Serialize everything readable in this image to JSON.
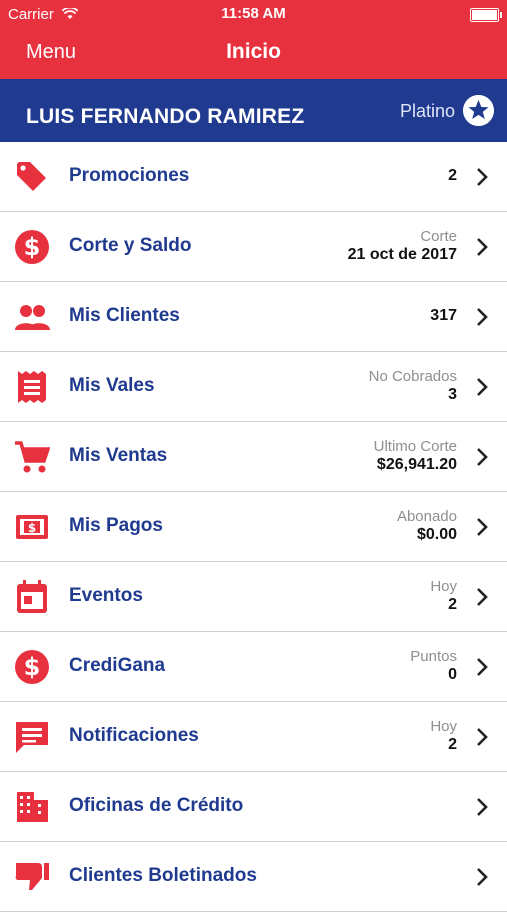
{
  "status": {
    "carrier": "Carrier",
    "time": "11:58 AM"
  },
  "nav": {
    "menu": "Menu",
    "title": "Inicio"
  },
  "user": {
    "name": "LUIS FERNANDO RAMIREZ",
    "tier": "Platino"
  },
  "colors": {
    "red": "#e8313f",
    "navy": "#1f3a8f"
  },
  "items": [
    {
      "label": "Promociones",
      "icon": "tag-icon",
      "sub": "",
      "value": "2"
    },
    {
      "label": "Corte y Saldo",
      "icon": "dollar-circle-icon",
      "sub": "Corte",
      "value": "21 oct de 2017"
    },
    {
      "label": "Mis Clientes",
      "icon": "people-icon",
      "sub": "",
      "value": "317"
    },
    {
      "label": "Mis Vales",
      "icon": "receipt-icon",
      "sub": "No Cobrados",
      "value": "3"
    },
    {
      "label": "Mis Ventas",
      "icon": "cart-icon",
      "sub": "Ultimo Corte",
      "value": "$26,941.20"
    },
    {
      "label": "Mis Pagos",
      "icon": "cash-icon",
      "sub": "Abonado",
      "value": "$0.00"
    },
    {
      "label": "Eventos",
      "icon": "calendar-icon",
      "sub": "Hoy",
      "value": "2"
    },
    {
      "label": "CrediGana",
      "icon": "dollar-circle-icon",
      "sub": "Puntos",
      "value": "0"
    },
    {
      "label": "Notificaciones",
      "icon": "chat-icon",
      "sub": "Hoy",
      "value": "2"
    },
    {
      "label": "Oficinas de Crédito",
      "icon": "building-icon",
      "sub": "",
      "value": ""
    },
    {
      "label": "Clientes Boletinados",
      "icon": "thumbs-down-icon",
      "sub": "",
      "value": ""
    }
  ]
}
